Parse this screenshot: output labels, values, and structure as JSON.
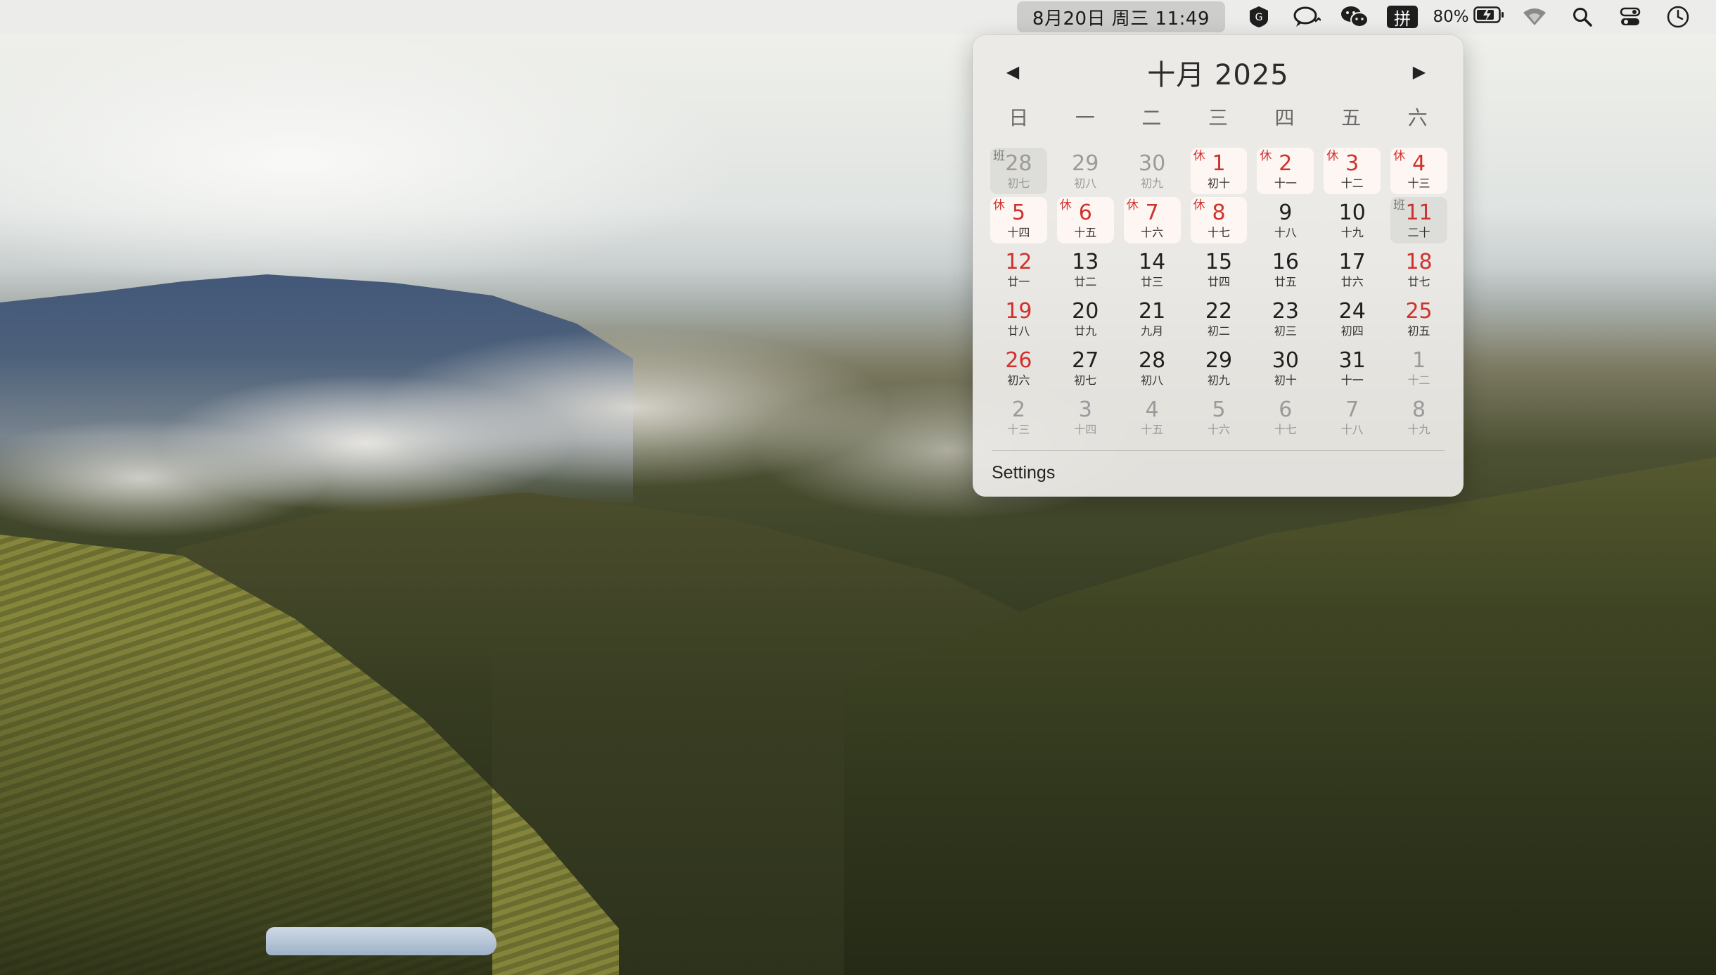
{
  "menubar": {
    "clock": "8月20日 周三  11:49",
    "input_method": "拼",
    "battery_percent": "80%",
    "icons": [
      "g-app-icon",
      "chat-bubble-icon",
      "wechat-icon",
      "input-method-icon",
      "battery-icon",
      "wifi-icon",
      "search-icon",
      "control-center-icon",
      "clock-icon"
    ]
  },
  "calendar": {
    "title": "十月 2025",
    "prev_glyph": "◀",
    "next_glyph": "▶",
    "weekdays": [
      "日",
      "一",
      "二",
      "三",
      "四",
      "五",
      "六"
    ],
    "rest_tag": "休",
    "work_tag": "班",
    "days": [
      {
        "d": "28",
        "l": "初七",
        "other": true,
        "tag": "班",
        "workday": true
      },
      {
        "d": "29",
        "l": "初八",
        "other": true
      },
      {
        "d": "30",
        "l": "初九",
        "other": true
      },
      {
        "d": "1",
        "l": "初十",
        "holiday": true,
        "tag": "休"
      },
      {
        "d": "2",
        "l": "十一",
        "holiday": true,
        "tag": "休"
      },
      {
        "d": "3",
        "l": "十二",
        "holiday": true,
        "tag": "休"
      },
      {
        "d": "4",
        "l": "十三",
        "holiday": true,
        "tag": "休"
      },
      {
        "d": "5",
        "l": "十四",
        "holiday": true,
        "tag": "休"
      },
      {
        "d": "6",
        "l": "十五",
        "holiday": true,
        "tag": "休"
      },
      {
        "d": "7",
        "l": "十六",
        "holiday": true,
        "tag": "休"
      },
      {
        "d": "8",
        "l": "十七",
        "holiday": true,
        "tag": "休"
      },
      {
        "d": "9",
        "l": "十八"
      },
      {
        "d": "10",
        "l": "十九"
      },
      {
        "d": "11",
        "l": "二十",
        "workday": true,
        "tag": "班",
        "weekend": true
      },
      {
        "d": "12",
        "l": "廿一",
        "weekend": true
      },
      {
        "d": "13",
        "l": "廿二"
      },
      {
        "d": "14",
        "l": "廿三"
      },
      {
        "d": "15",
        "l": "廿四"
      },
      {
        "d": "16",
        "l": "廿五"
      },
      {
        "d": "17",
        "l": "廿六"
      },
      {
        "d": "18",
        "l": "廿七",
        "weekend": true
      },
      {
        "d": "19",
        "l": "廿八",
        "weekend": true
      },
      {
        "d": "20",
        "l": "廿九"
      },
      {
        "d": "21",
        "l": "九月"
      },
      {
        "d": "22",
        "l": "初二"
      },
      {
        "d": "23",
        "l": "初三"
      },
      {
        "d": "24",
        "l": "初四"
      },
      {
        "d": "25",
        "l": "初五",
        "weekend": true
      },
      {
        "d": "26",
        "l": "初六",
        "weekend": true
      },
      {
        "d": "27",
        "l": "初七"
      },
      {
        "d": "28",
        "l": "初八"
      },
      {
        "d": "29",
        "l": "初九"
      },
      {
        "d": "30",
        "l": "初十"
      },
      {
        "d": "31",
        "l": "十一"
      },
      {
        "d": "1",
        "l": "十二",
        "other": true
      },
      {
        "d": "2",
        "l": "十三",
        "other": true
      },
      {
        "d": "3",
        "l": "十四",
        "other": true
      },
      {
        "d": "4",
        "l": "十五",
        "other": true
      },
      {
        "d": "5",
        "l": "十六",
        "other": true
      },
      {
        "d": "6",
        "l": "十七",
        "other": true
      },
      {
        "d": "7",
        "l": "十八",
        "other": true
      },
      {
        "d": "8",
        "l": "十九",
        "other": true
      }
    ],
    "settings_label": "Settings"
  },
  "colors": {
    "holiday_red": "#d0312d",
    "popover_bg": "#ecebe8"
  }
}
